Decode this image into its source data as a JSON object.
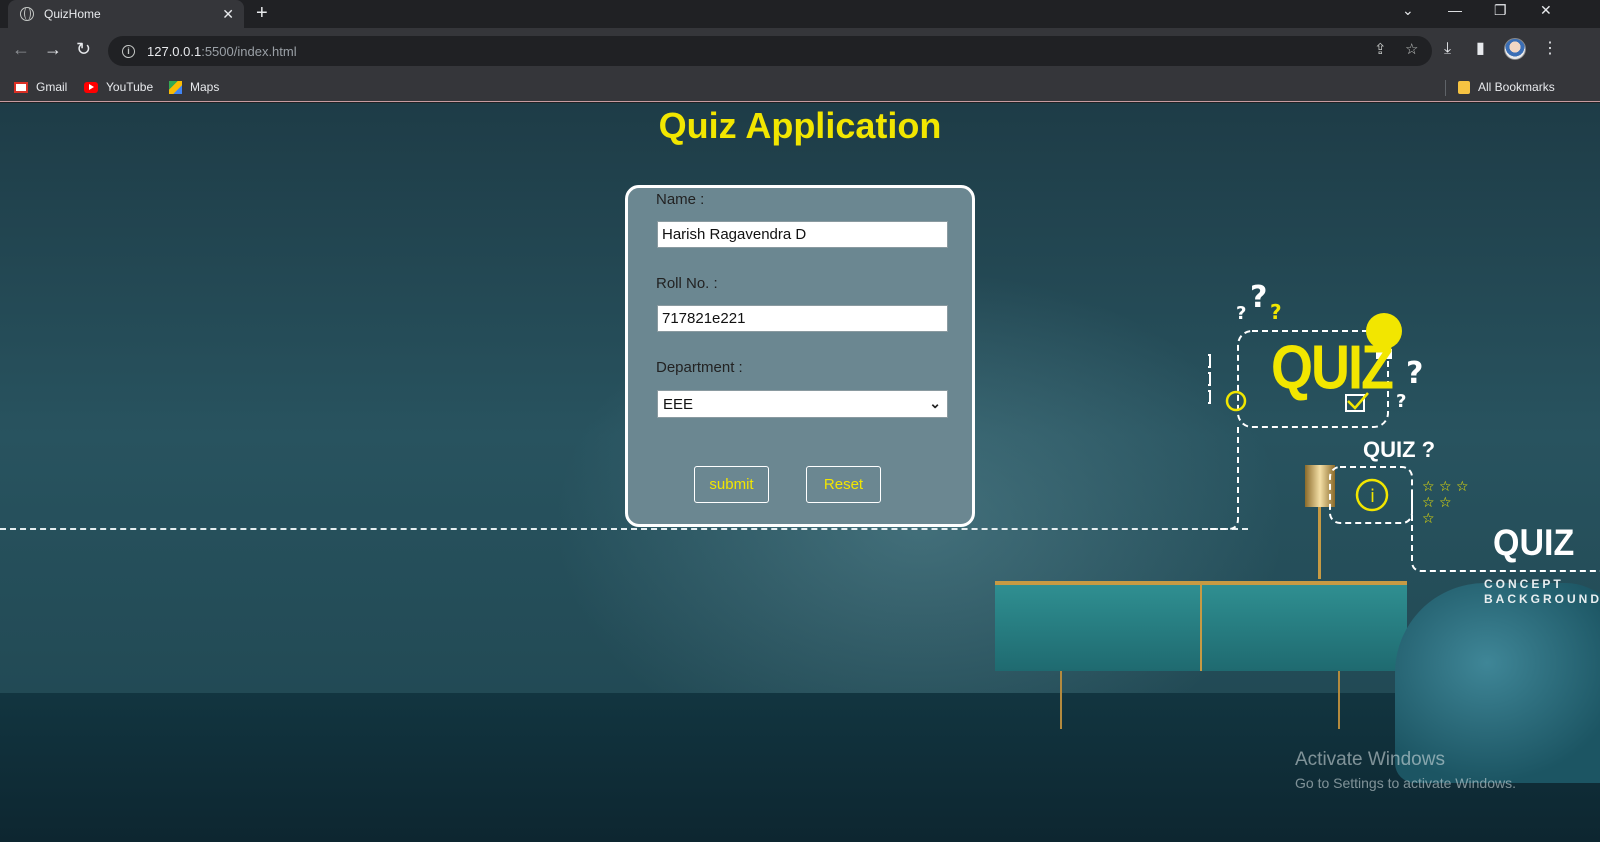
{
  "browser": {
    "tab_title": "QuizHome",
    "tab_close": "✕",
    "new_tab": "+",
    "url_host": "127.0.0.1",
    "url_path": ":5500/index.html",
    "bookmarks": [
      "Gmail",
      "YouTube",
      "Maps"
    ],
    "all_bookmarks": "All Bookmarks"
  },
  "page": {
    "title": "Quiz Application",
    "form": {
      "name_label": "Name :",
      "name_value": "Harish Ragavendra D",
      "roll_label": "Roll No. :",
      "roll_value": "717821e221",
      "dept_label": "Department :",
      "dept_value": "EEE",
      "submit_label": "submit",
      "reset_label": "Reset"
    },
    "illustration": {
      "quiz_big": "QUIZ",
      "quiz_small": "QUIZ ?",
      "quiz_white": "QUIZ",
      "concept": "CONCEPT",
      "background": "BACKGROUND"
    }
  },
  "watermark": {
    "line1": "Activate Windows",
    "line2": "Go to Settings to activate Windows."
  },
  "colors": {
    "accent_yellow": "#f2e600",
    "card_bg": "#6b8791"
  }
}
